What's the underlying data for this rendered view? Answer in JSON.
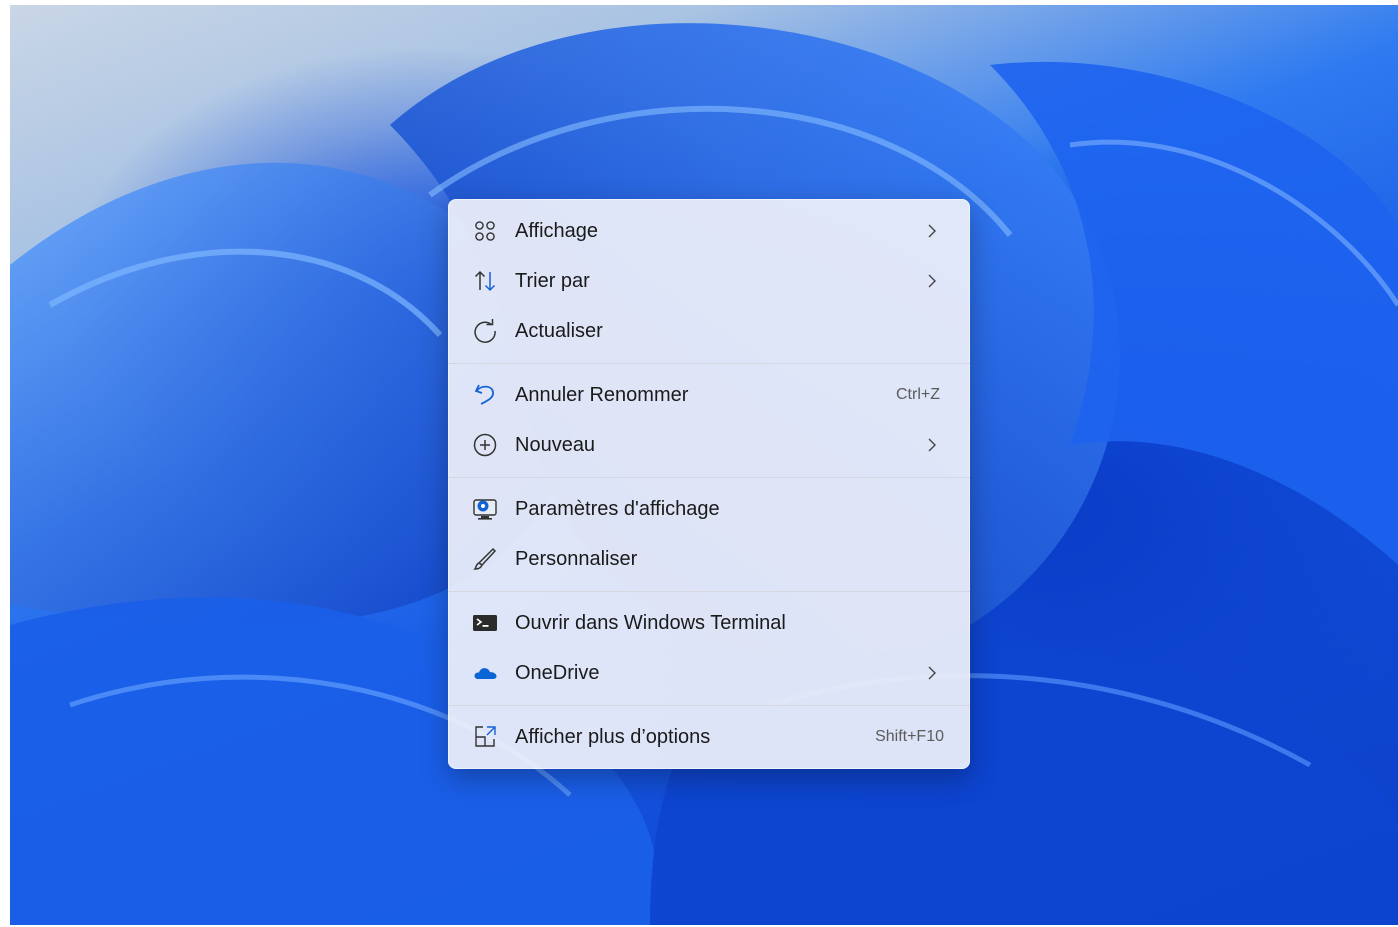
{
  "context_menu": {
    "groups": [
      [
        {
          "label": "Affichage",
          "icon": "grid-view-icon",
          "submenu": true
        },
        {
          "label": "Trier par",
          "icon": "sort-arrows-icon",
          "submenu": true
        },
        {
          "label": "Actualiser",
          "icon": "refresh-icon",
          "submenu": false
        }
      ],
      [
        {
          "label": "Annuler Renommer",
          "icon": "undo-icon",
          "shortcut": "Ctrl+Z"
        },
        {
          "label": "Nouveau",
          "icon": "add-circle-icon",
          "submenu": true
        }
      ],
      [
        {
          "label": "Paramètres d'affichage",
          "icon": "display-settings-icon"
        },
        {
          "label": "Personnaliser",
          "icon": "brush-icon"
        }
      ],
      [
        {
          "label": "Ouvrir dans Windows Terminal",
          "icon": "terminal-icon"
        },
        {
          "label": "OneDrive",
          "icon": "onedrive-cloud-icon",
          "submenu": true
        }
      ],
      [
        {
          "label": "Afficher plus d’options",
          "icon": "more-options-icon",
          "shortcut": "Shift+F10"
        }
      ]
    ]
  },
  "colors": {
    "accent": "#0a5bd6",
    "menu_background": "#eef0fa",
    "wallpaper_blue": "#1657e4"
  }
}
